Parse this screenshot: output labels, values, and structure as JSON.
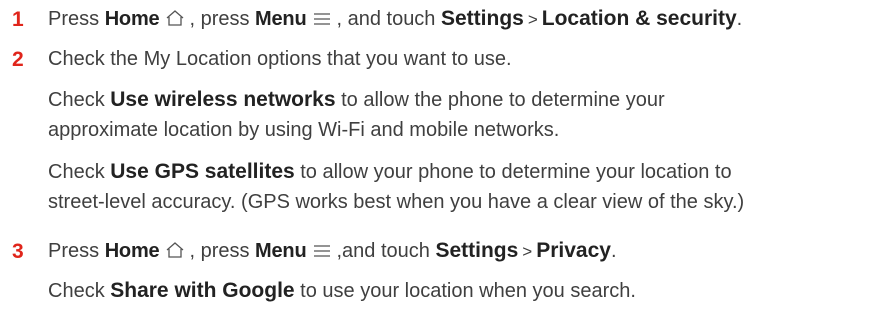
{
  "step1": {
    "number": "1",
    "t1": "Press ",
    "home": "Home",
    "t2": ", press ",
    "menu": "Menu",
    "t3": ", and touch ",
    "settings": "Settings",
    "sep": ">",
    "location_security": "Location & security",
    "t4": "."
  },
  "step2": {
    "number": "2",
    "text": "Check the My Location options that you want to use."
  },
  "para_wireless": {
    "t1": "Check ",
    "bold": "Use wireless networks",
    "t2": " to allow the phone to determine your",
    "line2": "approximate location by using Wi-Fi and mobile networks."
  },
  "para_gps": {
    "t1": "Check ",
    "bold": "Use GPS satellites",
    "t2": " to allow your phone to determine your location to",
    "line2": "street-level accuracy. (GPS works best when you have a clear view of the sky.)"
  },
  "step3": {
    "number": "3",
    "t1": "Press ",
    "home": "Home",
    "t2": ", press ",
    "menu": "Menu",
    "t3": ",and touch ",
    "settings": "Settings",
    "sep": ">",
    "privacy": "Privacy",
    "t4": "."
  },
  "para_share": {
    "t1": "Check ",
    "bold": "Share with Google",
    "t2": " to use your location when you search."
  },
  "colors": {
    "step_number": "#e0251b",
    "text": "#3f3f3f"
  },
  "icons": {
    "home": "home-icon",
    "menu": "menu-icon"
  }
}
